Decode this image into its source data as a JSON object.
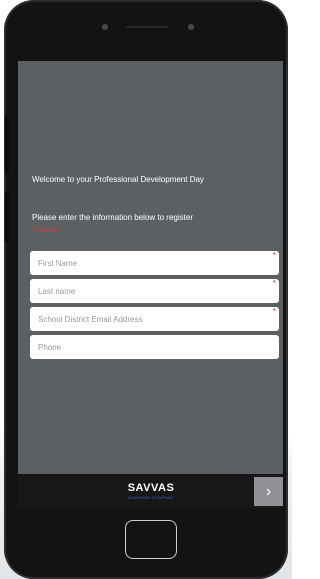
{
  "form": {
    "welcome": "Welcome to your Professional Development Day",
    "instructions": "Please enter the information below to register",
    "required_note": "* Required",
    "fields": [
      {
        "placeholder": "First Name",
        "required": true
      },
      {
        "placeholder": "Last name",
        "required": true
      },
      {
        "placeholder": "School District Email Address",
        "required": true
      },
      {
        "placeholder": "Phone",
        "required": false
      }
    ],
    "required_marker": "*"
  },
  "footer": {
    "logo_text": "SAVVAS",
    "logo_subtext": "LEARNING COMPANY",
    "next_icon": "chevron-right-icon",
    "next_glyph": "›"
  },
  "colors": {
    "screen_bg": "#5d6063",
    "footer_bg": "#161718",
    "required": "#d03a3a",
    "logo_accent": "#3f6ebf",
    "next_button": "#8f9194"
  }
}
